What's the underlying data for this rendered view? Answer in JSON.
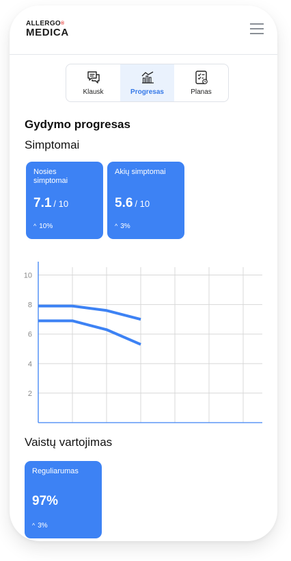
{
  "logo": {
    "line1": "ALLERGO",
    "mark": "®",
    "line2": "MEDICA"
  },
  "menu_icon": "hamburger-icon",
  "tabs": [
    {
      "label": "Klausk",
      "icon": "chat-icon",
      "active": false
    },
    {
      "label": "Progresas",
      "icon": "chart-icon",
      "active": true
    },
    {
      "label": "Planas",
      "icon": "checklist-icon",
      "active": false
    }
  ],
  "page_title": "Gydymo progresas",
  "symptoms": {
    "heading": "Simptomai",
    "cards": [
      {
        "title": "Nosies simptomai",
        "value": "7.1",
        "max": "/ 10",
        "caret": "^",
        "delta": "10%"
      },
      {
        "title": "Akių simptomai",
        "value": "5.6",
        "max": "/ 10",
        "caret": "^",
        "delta": "3%"
      }
    ]
  },
  "chart_data": {
    "type": "line",
    "x": [
      1,
      2,
      3,
      4,
      5,
      6,
      7
    ],
    "ylim": [
      0,
      11
    ],
    "yticks": [
      "2",
      "4",
      "6",
      "8",
      "10"
    ],
    "ytick_values": [
      2,
      4,
      6,
      8,
      10
    ],
    "grid": true,
    "colors": {
      "line": "#3d82f4",
      "grid": "#d8d8d8",
      "axis": "#3d82f4"
    },
    "series": [
      {
        "values": [
          7.9,
          7.9,
          7.6,
          7.0
        ]
      },
      {
        "values": [
          6.9,
          6.9,
          6.3,
          5.3
        ]
      }
    ]
  },
  "medication": {
    "heading": "Vaistų vartojimas",
    "card": {
      "title": "Reguliarumas",
      "value": "97%",
      "caret": "^",
      "delta": "3%"
    }
  },
  "colors": {
    "accent": "#3d82f4",
    "active_tab_bg": "#eaf2fd",
    "active_tab_text": "#3579e8"
  }
}
